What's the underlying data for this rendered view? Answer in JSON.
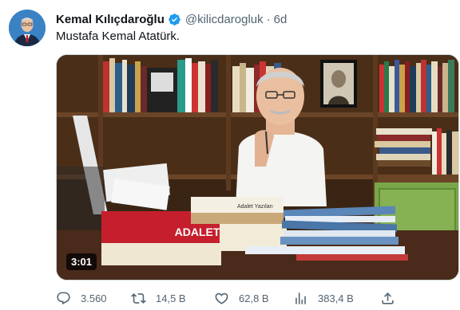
{
  "tweet": {
    "author_name": "Kemal Kılıçdaroğlu",
    "handle": "@kilicdarogluk",
    "separator": "·",
    "time": "6d",
    "text": "Mustafa Kemal Atatürk.",
    "video": {
      "duration": "3:01",
      "book_title": "ADALET",
      "book_title_small": "Adalet Yazıları"
    },
    "actions": {
      "replies": "3.560",
      "retweets": "14,5 B",
      "likes": "62,8 B",
      "views": "383,4 B"
    }
  },
  "colors": {
    "verified": "#1d9bf0",
    "secondary_text": "#536471"
  }
}
